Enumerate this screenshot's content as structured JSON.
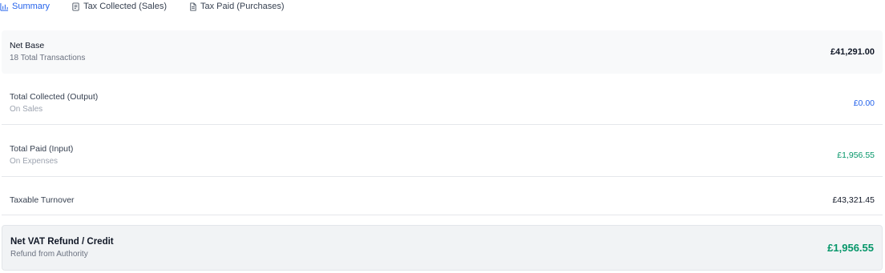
{
  "tabs": [
    {
      "label": "Summary",
      "icon": "bar-chart-icon",
      "active": true
    },
    {
      "label": "Tax Collected (Sales)",
      "icon": "receipt-icon",
      "active": false
    },
    {
      "label": "Tax Paid (Purchases)",
      "icon": "document-icon",
      "active": false
    }
  ],
  "summary": {
    "net_base": {
      "title": "Net Base",
      "subtitle": "18 Total Transactions",
      "amount": "£41,291.00"
    },
    "total_collected": {
      "title": "Total Collected (Output)",
      "subtitle": "On Sales",
      "amount": "£0.00"
    },
    "total_paid": {
      "title": "Total Paid (Input)",
      "subtitle": "On Expenses",
      "amount": "£1,956.55"
    },
    "taxable_turnover": {
      "title": "Taxable Turnover",
      "amount": "£43,321.45"
    },
    "net_vat": {
      "title": "Net VAT Refund / Credit",
      "subtitle": "Refund from Authority",
      "amount": "£1,956.55"
    }
  },
  "colors": {
    "accent": "#2563eb",
    "positive": "#059669"
  }
}
